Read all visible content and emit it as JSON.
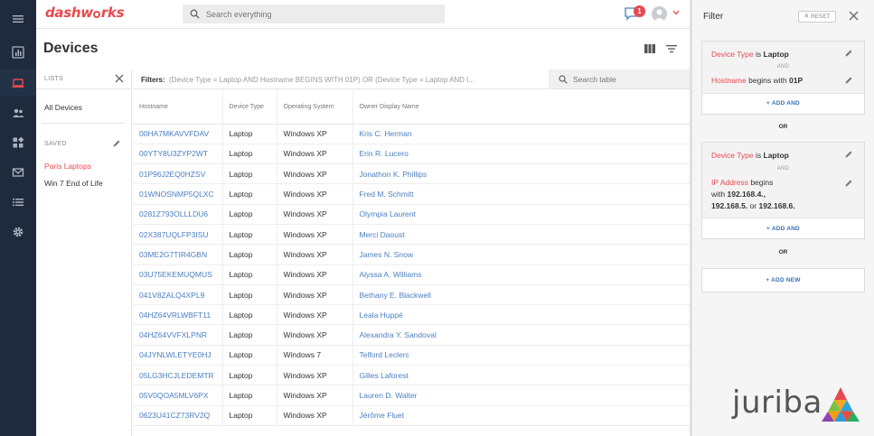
{
  "app": {
    "logo_prefix": "dash",
    "logo_mid": "w",
    "logo_suffix": "rks",
    "search_placeholder": "Search everything",
    "notification_count": "1"
  },
  "page": {
    "title": "Devices"
  },
  "lists_panel": {
    "heading": "LISTS",
    "all_devices": "All Devices",
    "saved_heading": "SAVED",
    "saved_items": [
      "Paris Laptops",
      "Win 7 End of Life"
    ]
  },
  "filterbar": {
    "label": "Filters:",
    "query": "(Device Type = Laptop AND Hostname BEGINS WITH 01P) OR (Device Type = Laptop AND I...",
    "table_search_placeholder": "Search table"
  },
  "table": {
    "columns": [
      "Hostname",
      "Device Type",
      "Operating System",
      "Owner Display Name"
    ],
    "rows": [
      [
        "00HA7MKAVVFDAV",
        "Laptop",
        "Windows XP",
        "Kris C. Herman"
      ],
      [
        "00YTY8U3ZYP2WT",
        "Laptop",
        "Windows XP",
        "Erin R. Lucero"
      ],
      [
        "01P96J2EQ0HZSV",
        "Laptop",
        "Windows XP",
        "Jonathon K. Phillips"
      ],
      [
        "01WNOSNMP5QLXC",
        "Laptop",
        "Windows XP",
        "Fred M. Schmitt"
      ],
      [
        "0281Z793OLLLDU6",
        "Laptop",
        "Windows XP",
        "Olympia Laurent"
      ],
      [
        "02X387UQLFP3ISU",
        "Laptop",
        "Windows XP",
        "Merci Daoust"
      ],
      [
        "03ME2G7TIR4GBN",
        "Laptop",
        "Windows XP",
        "James N. Snow"
      ],
      [
        "03U75EKEMUQMUS",
        "Laptop",
        "Windows XP",
        "Alyssa A. Williams"
      ],
      [
        "041V8ZALQ4XPL9",
        "Laptop",
        "Windows XP",
        "Bethany E. Blackwell"
      ],
      [
        "04HZ64VRLWBFT11",
        "Laptop",
        "Windows XP",
        "Leala Huppé"
      ],
      [
        "04HZ64VVFXLPNR",
        "Laptop",
        "Windows XP",
        "Alexandra Y. Sandoval"
      ],
      [
        "04JYNLWLETYE0HJ",
        "Laptop",
        "Windows 7",
        "Telford Leclerc"
      ],
      [
        "05LG3HCJLEDEMTR",
        "Laptop",
        "Windows XP",
        "Gilles Laforest"
      ],
      [
        "05V0QOA5MLV6PX",
        "Laptop",
        "Windows XP",
        "Lauren D. Walter"
      ],
      [
        "0623U41CZ73RV2Q",
        "Laptop",
        "Windows XP",
        "Jérôme Fluet"
      ]
    ]
  },
  "filter_panel": {
    "title": "Filter",
    "reset": "RESET",
    "and_label": "AND",
    "or_label": "OR",
    "add_and": "ADD AND",
    "add_new": "ADD NEW",
    "group1": {
      "cond1": {
        "field": "Device Type",
        "op": " is ",
        "value": "Laptop"
      },
      "cond2": {
        "field": "Hostname",
        "op": " begins with ",
        "value": "01P"
      }
    },
    "group2": {
      "cond1": {
        "field": "Device Type",
        "op": " is ",
        "value": "Laptop"
      },
      "cond2": {
        "field": "IP Address",
        "op": " begins",
        "line2_prefix": "with ",
        "v1": "192.168.4.,",
        "v2": "192.168.5.",
        "mid": " or ",
        "v3": "192.168.6."
      }
    }
  },
  "brand": {
    "name": "juriba"
  },
  "colors": {
    "accent": "#e8494f",
    "link": "#4a7fc1",
    "rail": "#1f2a3c"
  }
}
